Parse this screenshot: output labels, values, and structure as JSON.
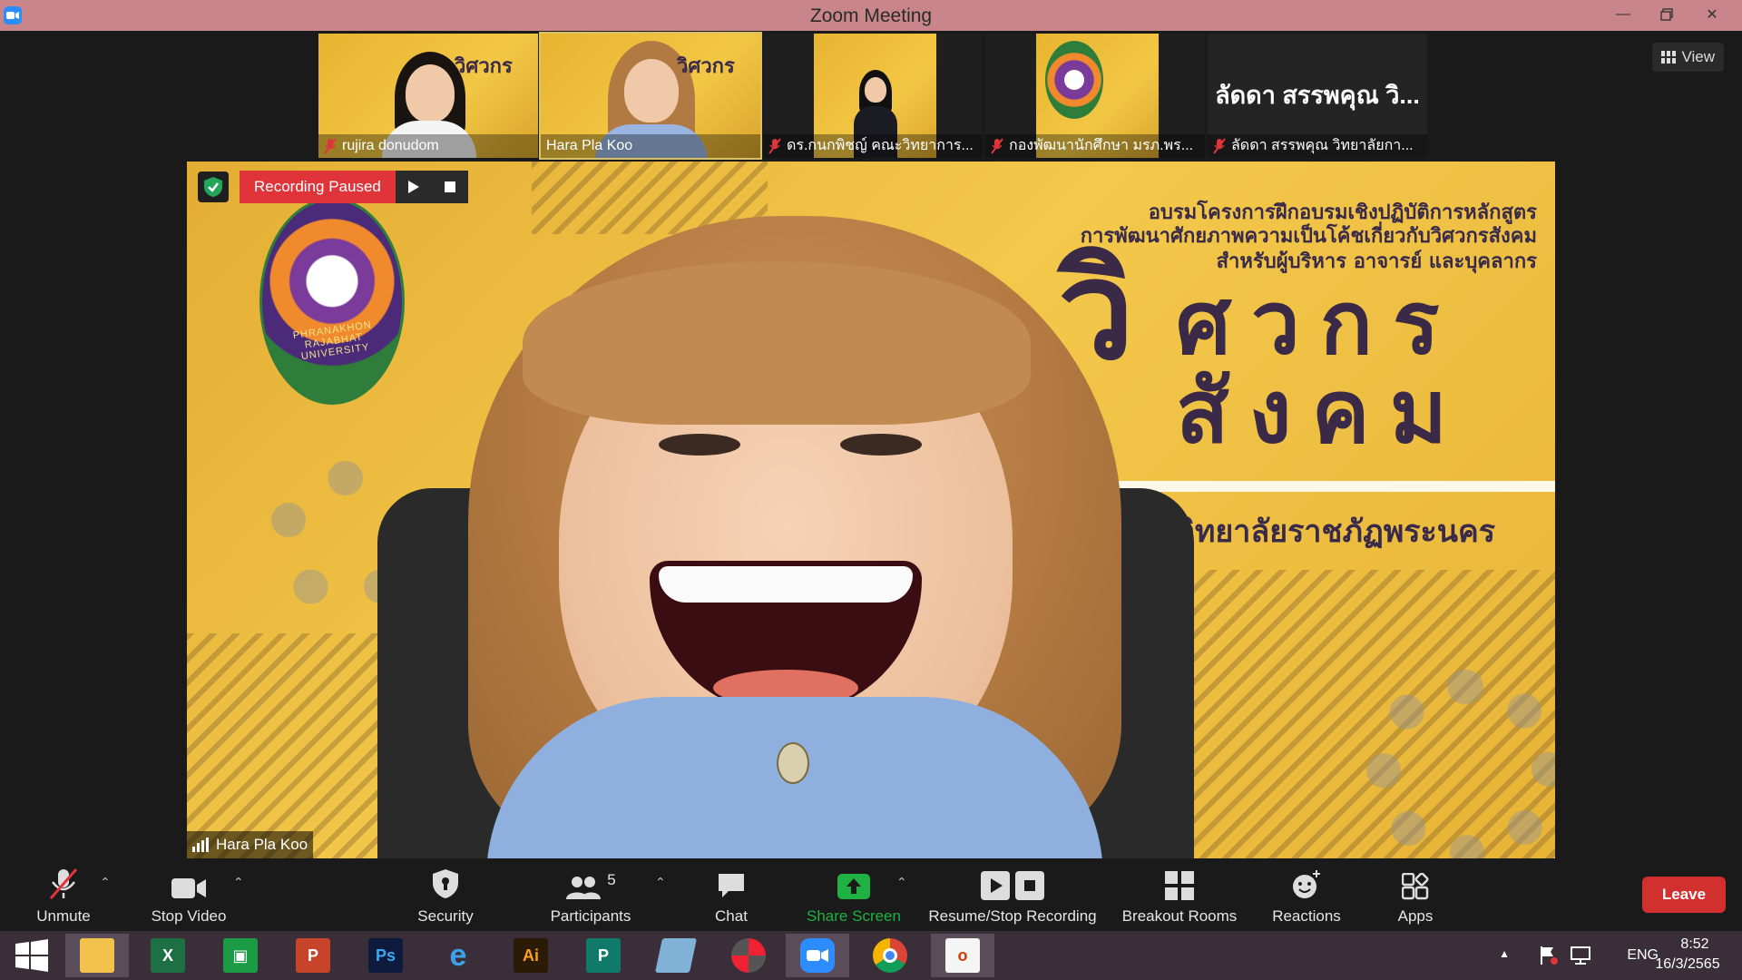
{
  "window": {
    "title": "Zoom Meeting"
  },
  "thumbnails": [
    {
      "name": "rujira donudom",
      "muted": true
    },
    {
      "name": "Hara Pla Koo",
      "muted": false
    },
    {
      "name": "ดร.กนกพิชญ์ คณะวิทยาการ...",
      "muted": true
    },
    {
      "name": "กองพัฒนานักศึกษา มรภ.พร...",
      "muted": true
    },
    {
      "name": "ลัดดา สรรพคุณ วิทยาลัยกา...",
      "display_name": "ลัดดา สรรพคุณ วิ...",
      "muted": true
    }
  ],
  "view_button": {
    "label": "View"
  },
  "recording": {
    "status": "Recording Paused"
  },
  "main_video": {
    "speaker": "Hara Pla Koo",
    "banner_lines": [
      "อบรมโครงการฝึกอบรมเชิงปฏิบัติการหลักสูตร",
      "การพัฒนาศักยภาพความเป็นโค้ชเกี่ยวกับวิศวกรสังคม",
      "สำหรับผู้บริหาร อาจารย์ และบุคลากร"
    ],
    "big_letter": "วิ",
    "big_line1": "ศวกร",
    "big_line2": "สังคม",
    "university_text": "าวิทยาลัยราชภัฏพระนคร",
    "seal_text": "PHRANAKHON RAJABHAT UNIVERSITY"
  },
  "toolbar": {
    "unmute": "Unmute",
    "stop_video": "Stop Video",
    "security": "Security",
    "participants": "Participants",
    "participants_count": "5",
    "chat": "Chat",
    "share_screen": "Share Screen",
    "recording": "Resume/Stop Recording",
    "breakout": "Breakout Rooms",
    "reactions": "Reactions",
    "apps": "Apps",
    "leave": "Leave"
  },
  "taskbar": {
    "apps": [
      "start",
      "file-explorer",
      "excel",
      "store",
      "powerpoint",
      "photoshop",
      "internet-explorer",
      "illustrator",
      "publisher",
      "notes",
      "photoscape",
      "zoom",
      "chrome",
      "office"
    ],
    "lang": "ENG",
    "time": "8:52",
    "date": "16/3/2565"
  },
  "colors": {
    "accent_red": "#d22f2f",
    "share_green": "#1fb141",
    "banner_yellow": "#f2c744"
  }
}
